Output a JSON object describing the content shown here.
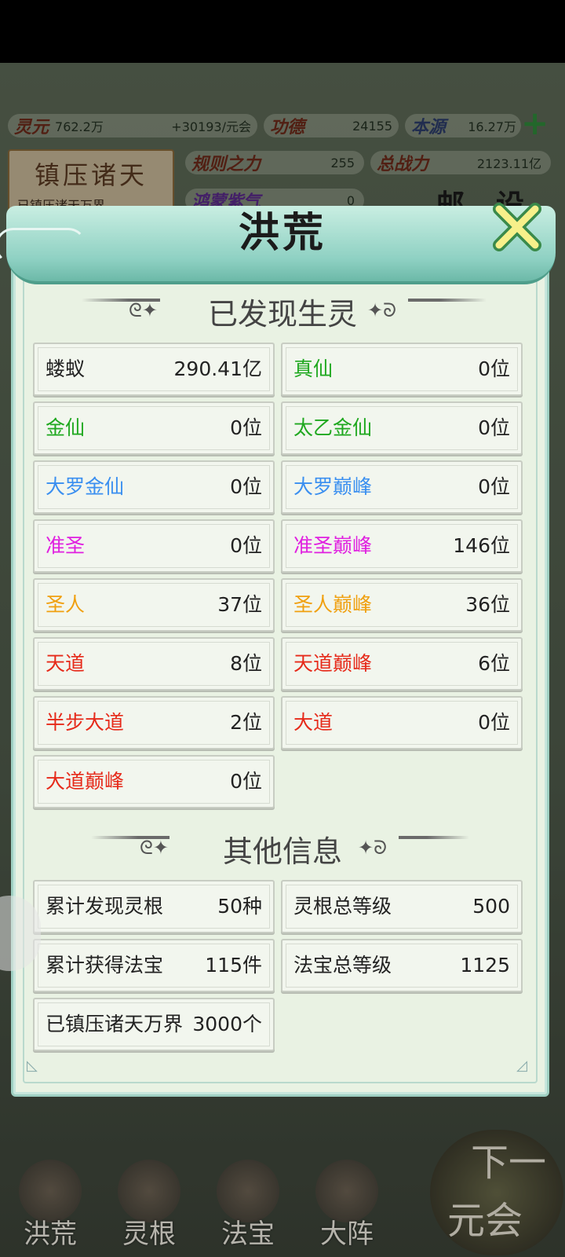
{
  "colors": {
    "white": "#222222",
    "green": "#1fa81f",
    "blue": "#3a8ff0",
    "purple": "#e020e0",
    "orange": "#f0a010",
    "red": "#e62a1a"
  },
  "background": {
    "resources": {
      "lingyuan_name": "灵元",
      "lingyuan_value": "762.2万",
      "lingyuan_rate": "+30193/元会",
      "gongde_name": "功德",
      "gongde_value": "24155",
      "benyuan_name": "本源",
      "benyuan_value": "16.27万",
      "guize_name": "规则之力",
      "guize_value": "255",
      "zongzhanli_name": "总战力",
      "zongzhanli_value": "2123.11亿",
      "third_name": "鸿蒙紫气",
      "third_value": "0"
    },
    "suppress_card": {
      "title": "镇压诸天",
      "subtitle": "已镇压诸天万界"
    },
    "mail_label": "邮",
    "settings_label": "设"
  },
  "modal": {
    "title": "洪荒",
    "section1_title": "已发现生灵",
    "creatures": [
      {
        "name": "蝼蚁",
        "value": "290.41亿",
        "color": "white"
      },
      {
        "name": "真仙",
        "value": "0位",
        "color": "green"
      },
      {
        "name": "金仙",
        "value": "0位",
        "color": "green"
      },
      {
        "name": "太乙金仙",
        "value": "0位",
        "color": "green"
      },
      {
        "name": "大罗金仙",
        "value": "0位",
        "color": "blue"
      },
      {
        "name": "大罗巅峰",
        "value": "0位",
        "color": "blue"
      },
      {
        "name": "准圣",
        "value": "0位",
        "color": "purple"
      },
      {
        "name": "准圣巅峰",
        "value": "146位",
        "color": "purple"
      },
      {
        "name": "圣人",
        "value": "37位",
        "color": "orange"
      },
      {
        "name": "圣人巅峰",
        "value": "36位",
        "color": "orange"
      },
      {
        "name": "天道",
        "value": "8位",
        "color": "red"
      },
      {
        "name": "天道巅峰",
        "value": "6位",
        "color": "red"
      },
      {
        "name": "半步大道",
        "value": "2位",
        "color": "red"
      },
      {
        "name": "大道",
        "value": "0位",
        "color": "red"
      },
      {
        "name": "大道巅峰",
        "value": "0位",
        "color": "red"
      }
    ],
    "section2_title": "其他信息",
    "other_info": [
      {
        "name": "累计发现灵根",
        "value": "50种"
      },
      {
        "name": "灵根总等级",
        "value": "500"
      },
      {
        "name": "累计获得法宝",
        "value": "115件"
      },
      {
        "name": "法宝总等级",
        "value": "1125"
      },
      {
        "name": "已镇压诸天万界",
        "value": "3000个"
      }
    ]
  },
  "bottom_nav": {
    "items": [
      "洪荒",
      "灵根",
      "法宝",
      "大阵"
    ],
    "next_line1": "下一",
    "next_line2": "元会"
  }
}
